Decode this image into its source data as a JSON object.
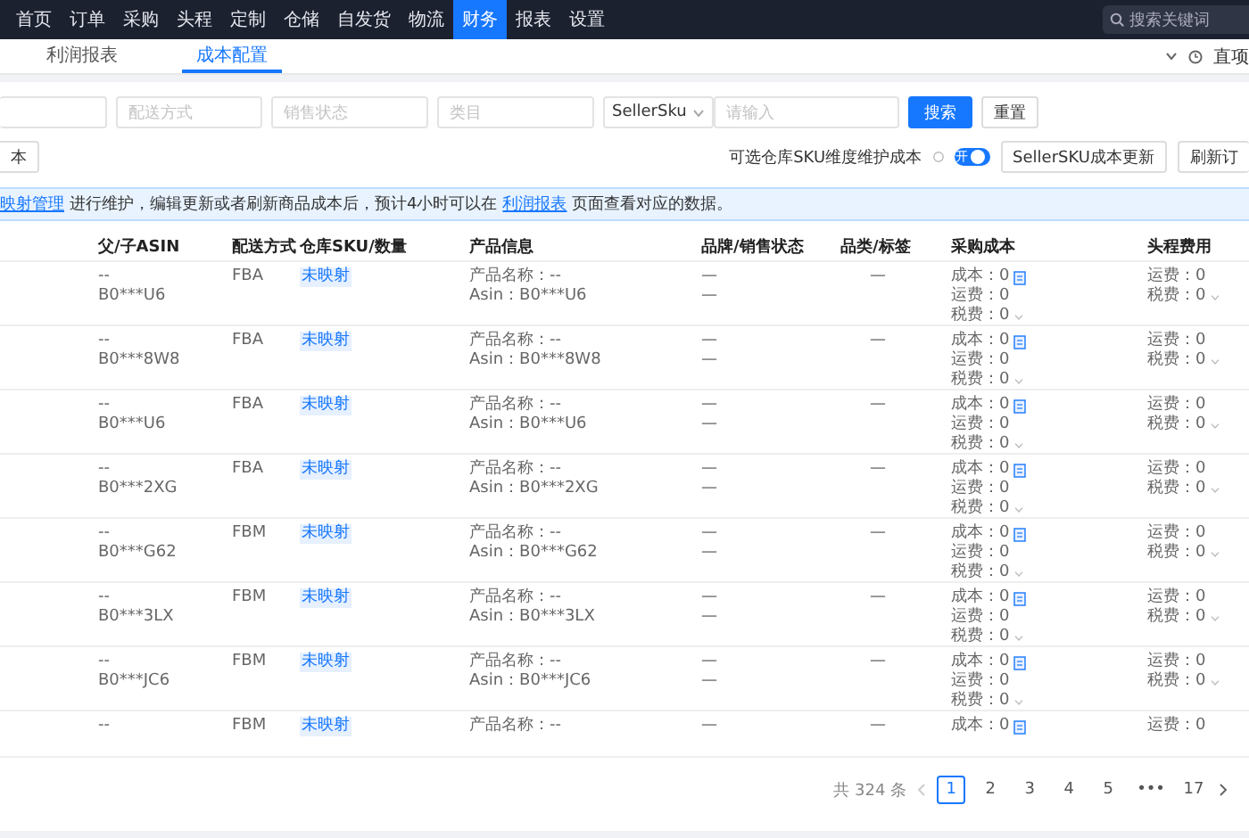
{
  "nav": {
    "items": [
      {
        "label": "首页",
        "selected": false
      },
      {
        "label": "订单",
        "selected": false
      },
      {
        "label": "采购",
        "selected": false
      },
      {
        "label": "头程",
        "selected": false
      },
      {
        "label": "定制",
        "selected": false
      },
      {
        "label": "仓储",
        "selected": false
      },
      {
        "label": "自发货",
        "selected": false
      },
      {
        "label": "物流",
        "selected": false
      },
      {
        "label": "财务",
        "selected": true
      },
      {
        "label": "报表",
        "selected": false
      },
      {
        "label": "设置",
        "selected": false
      }
    ],
    "search": {
      "placeholder": "搜索关键词"
    }
  },
  "tabs": [
    {
      "label": "利润报表",
      "selected": false
    },
    {
      "label": "成本配置",
      "selected": true
    }
  ],
  "tab_bar_right": {
    "label": "直项"
  },
  "filters": {
    "fields": [
      {
        "placeholder": "配送方式"
      },
      {
        "placeholder": "销售状态"
      },
      {
        "placeholder": "类目"
      }
    ],
    "select": {
      "value": "SellerSku"
    },
    "input": {
      "placeholder": "请输入"
    },
    "buttons": [
      {
        "label": "搜索",
        "kind": "primary"
      },
      {
        "label": "重置",
        "kind": "default"
      }
    ]
  },
  "toolbar": {
    "left_button": "本",
    "toggle_label": "可选仓库SKU维度维护成本",
    "toggle": {
      "on": true,
      "label": "开"
    },
    "buttons": [
      "SellerSKU成本更新",
      "刷新订"
    ]
  },
  "notice": {
    "link_1": "映射管理",
    "text_1": "进行维护，编辑更新或者刷新商品成本后，预计4小时可以在",
    "link_2": "利润报表",
    "text_2": "页面查看对应的数据。"
  },
  "table": {
    "columns": [
      "父/子ASIN",
      "配送方式",
      "仓库SKU/数量",
      "产品信息",
      "品牌/销售状态",
      "品类/标签",
      "采购成本",
      "头程费用"
    ],
    "rows": [
      {
        "parent": "--",
        "child": "B0***U6",
        "shipping": "FBA",
        "sku": "未映射",
        "product_name": "产品名称：--",
        "asin": "Asin：B0***U6",
        "brand": "—",
        "status": "—",
        "category": "—",
        "cost": "成本：0",
        "freight": "运费：0",
        "tax": "税费：0",
        "head_freight": "运费：0",
        "head_tax": "税费：0"
      },
      {
        "parent": "--",
        "child": "B0***8W8",
        "shipping": "FBA",
        "sku": "未映射",
        "product_name": "产品名称：--",
        "asin": "Asin：B0***8W8",
        "brand": "—",
        "status": "—",
        "category": "—",
        "cost": "成本：0",
        "freight": "运费：0",
        "tax": "税费：0",
        "head_freight": "运费：0",
        "head_tax": "税费：0"
      },
      {
        "parent": "--",
        "child": "B0***U6",
        "shipping": "FBA",
        "sku": "未映射",
        "product_name": "产品名称：--",
        "asin": "Asin：B0***U6",
        "brand": "—",
        "status": "—",
        "category": "—",
        "cost": "成本：0",
        "freight": "运费：0",
        "tax": "税费：0",
        "head_freight": "运费：0",
        "head_tax": "税费：0"
      },
      {
        "parent": "--",
        "child": "B0***2XG",
        "shipping": "FBA",
        "sku": "未映射",
        "product_name": "产品名称：--",
        "asin": "Asin：B0***2XG",
        "brand": "—",
        "status": "—",
        "category": "—",
        "cost": "成本：0",
        "freight": "运费：0",
        "tax": "税费：0",
        "head_freight": "运费：0",
        "head_tax": "税费：0"
      },
      {
        "parent": "--",
        "child": "B0***G62",
        "shipping": "FBM",
        "sku": "未映射",
        "product_name": "产品名称：--",
        "asin": "Asin：B0***G62",
        "brand": "—",
        "status": "—",
        "category": "—",
        "cost": "成本：0",
        "freight": "运费：0",
        "tax": "税费：0",
        "head_freight": "运费：0",
        "head_tax": "税费：0"
      },
      {
        "parent": "--",
        "child": "B0***3LX",
        "shipping": "FBM",
        "sku": "未映射",
        "product_name": "产品名称：--",
        "asin": "Asin：B0***3LX",
        "brand": "—",
        "status": "—",
        "category": "—",
        "cost": "成本：0",
        "freight": "运费：0",
        "tax": "税费：0",
        "head_freight": "运费：0",
        "head_tax": "税费：0"
      },
      {
        "parent": "--",
        "child": "B0***JC6",
        "shipping": "FBM",
        "sku": "未映射",
        "product_name": "产品名称：--",
        "asin": "Asin：B0***JC6",
        "brand": "—",
        "status": "—",
        "category": "—",
        "cost": "成本：0",
        "freight": "运费：0",
        "tax": "税费：0",
        "head_freight": "运费：0",
        "head_tax": "税费：0"
      },
      {
        "parent": "--",
        "shipping": "FBM",
        "sku": "未映射",
        "product_name": "产品名称：--",
        "brand": "—",
        "category": "—",
        "cost": "成本：0",
        "head_freight": "运费：0"
      }
    ]
  },
  "pagination": {
    "total": "共 324 条",
    "pages": [
      {
        "label": "1",
        "selected": true
      },
      {
        "label": "2",
        "selected": false
      },
      {
        "label": "3",
        "selected": false
      },
      {
        "label": "4",
        "selected": false
      },
      {
        "label": "5",
        "selected": false
      },
      {
        "label": "•••",
        "selected": false
      },
      {
        "label": "17",
        "selected": false
      }
    ]
  }
}
